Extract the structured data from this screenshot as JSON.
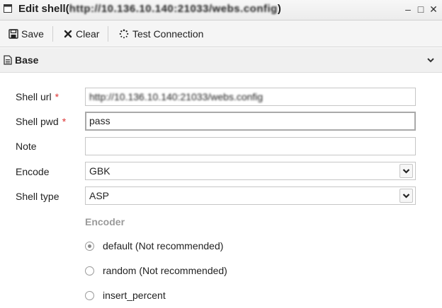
{
  "window": {
    "title_prefix": "Edit shell(",
    "title_url": "http://10.136.10.140:21033/webs.config",
    "title_suffix": ")",
    "minimize_glyph": "–",
    "maximize_glyph": "□",
    "close_glyph": "✕"
  },
  "toolbar": {
    "save_label": "Save",
    "clear_label": "Clear",
    "test_label": "Test Connection"
  },
  "section": {
    "title": "Base",
    "icons": [
      "document-icon",
      "chevron-down-icon"
    ]
  },
  "form": {
    "shell_url": {
      "label": "Shell url",
      "required_mark": "*",
      "value": "http://10.136.10.140:21033/webs.config"
    },
    "shell_pwd": {
      "label": "Shell pwd",
      "required_mark": "*",
      "value": "pass"
    },
    "note": {
      "label": "Note",
      "value": ""
    },
    "encode": {
      "label": "Encode",
      "value": "GBK"
    },
    "shell_type": {
      "label": "Shell type",
      "value": "ASP"
    }
  },
  "encoder": {
    "title": "Encoder",
    "options": [
      {
        "label": "default (Not recommended)",
        "checked": true
      },
      {
        "label": "random (Not recommended)",
        "checked": false
      },
      {
        "label": "insert_percent",
        "checked": false
      }
    ]
  },
  "colors": {
    "required": "#dd3333",
    "section_bg": "#f0f0f0",
    "toolbar_bg": "#f5f5f5",
    "encoder_title": "#9a9a9a"
  }
}
